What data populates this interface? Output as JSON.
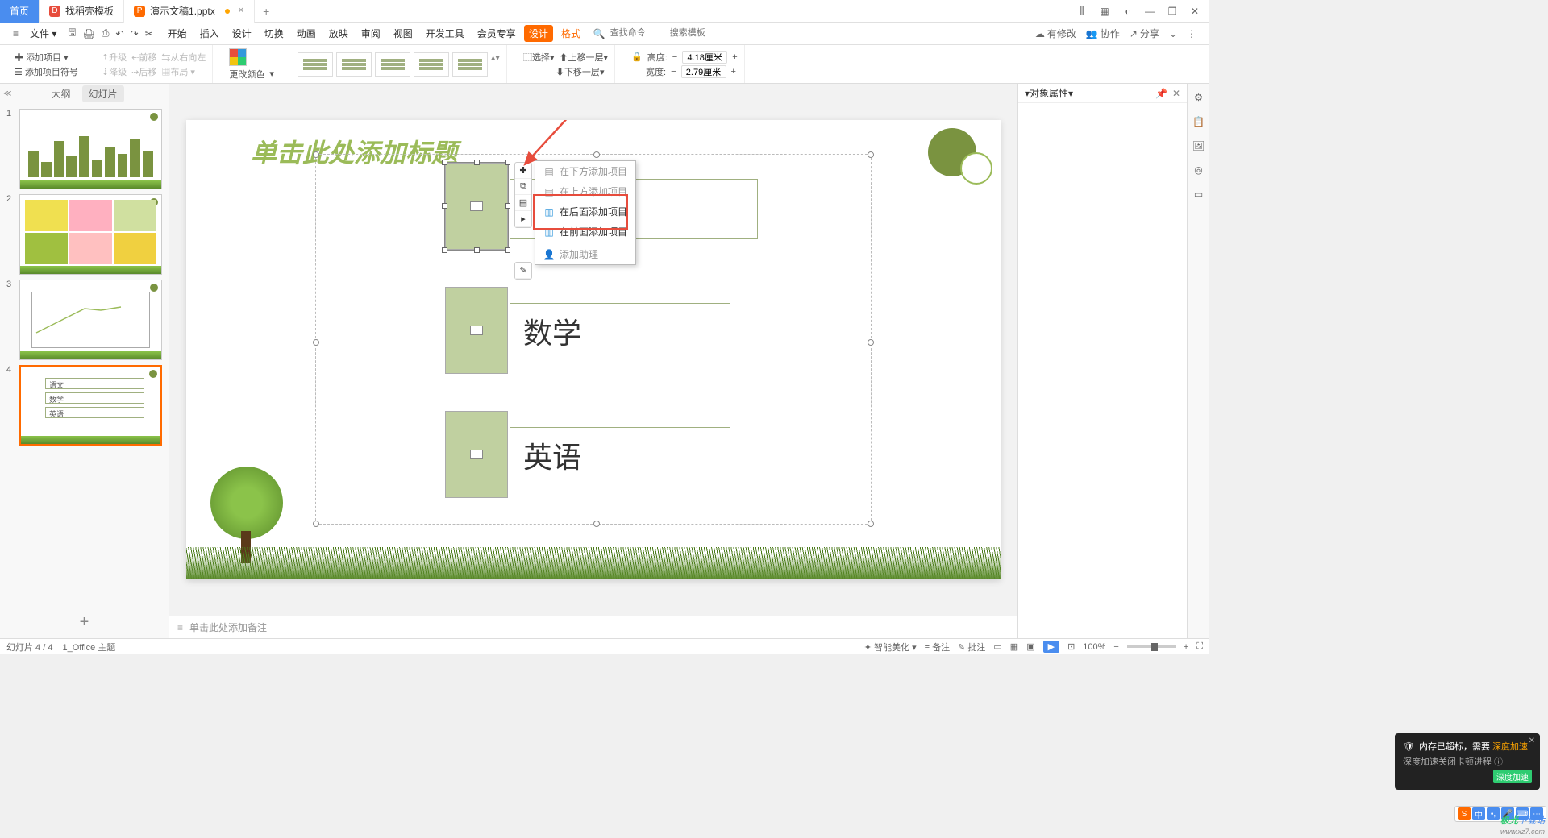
{
  "titlebar": {
    "tabs": [
      {
        "label": "首页"
      },
      {
        "label": "找稻壳模板"
      },
      {
        "label": "演示文稿1.pptx"
      }
    ]
  },
  "menubar": {
    "file": "文件",
    "items": [
      "开始",
      "插入",
      "设计",
      "切换",
      "动画",
      "放映",
      "审阅",
      "视图",
      "开发工具",
      "会员专享"
    ],
    "design_tab": "设计",
    "format_tab": "格式",
    "search_icon_label": "查找命令",
    "search_placeholder": "搜索模板",
    "right": {
      "pending": "有修改",
      "coop": "协作",
      "share": "分享"
    }
  },
  "ribbon": {
    "add_item": "添加项目",
    "add_bullet": "添加项目符号",
    "upgrade": "升级",
    "forward": "前移",
    "rtl": "从右向左",
    "downgrade": "降级",
    "back": "后移",
    "layout": "布局",
    "change_color": "更改颜色",
    "select": "选择",
    "up_layer": "上移一层",
    "down_layer": "下移一层",
    "height_label": "高度:",
    "height_val": "4.18厘米",
    "width_label": "宽度:",
    "width_val": "2.79厘米"
  },
  "slidepanel": {
    "outline": "大纲",
    "slides": "幻灯片",
    "thumbs": [
      {
        "n": "1"
      },
      {
        "n": "2"
      },
      {
        "n": "3"
      },
      {
        "n": "4"
      }
    ],
    "thumb4_items": [
      "语文",
      "数学",
      "英语"
    ]
  },
  "canvas": {
    "title": "单击此处添加标题",
    "items": [
      {
        "label": ""
      },
      {
        "label": "数学"
      },
      {
        "label": "英语"
      }
    ]
  },
  "context_menu": {
    "add_below": "在下方添加项目",
    "add_above": "在上方添加项目",
    "add_after": "在后面添加项目",
    "add_before": "在前面添加项目",
    "add_assistant": "添加助理"
  },
  "notes": {
    "placeholder": "单击此处添加备注"
  },
  "proppanel": {
    "title": "对象属性"
  },
  "statusbar": {
    "slide": "幻灯片 4 / 4",
    "theme": "1_Office 主题",
    "beautify": "智能美化",
    "notes": "备注",
    "comments": "批注",
    "zoom": "100%"
  },
  "toast": {
    "title": "内存已超标，需要",
    "link": "深度加速",
    "sub": "深度加速关闭卡顿进程",
    "btn": "深度加速"
  },
  "ime": {
    "a": "中",
    "b": "•,",
    "c": "🎤",
    "d": "⌨",
    "e": "⋯"
  },
  "watermark": {
    "brand": "极光",
    "suffix": "下载站",
    "url": "www.xz7.com"
  }
}
